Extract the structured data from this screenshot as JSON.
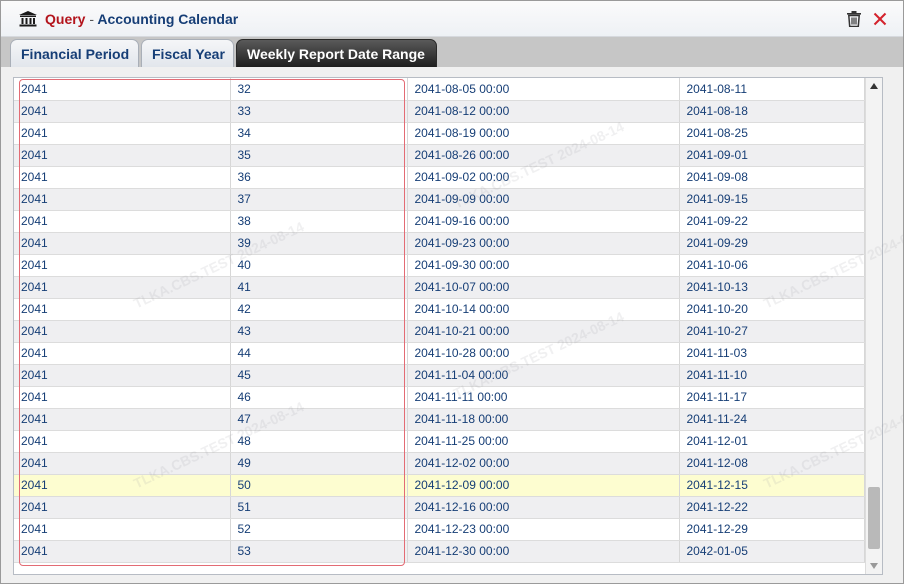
{
  "window": {
    "title_prefix": "Query",
    "title_separator": "-",
    "title": "Accounting Calendar",
    "icons": {
      "app": "bank-icon",
      "delete": "trash-icon",
      "close": "close-icon"
    }
  },
  "tabs": [
    {
      "label": "Financial Period",
      "active": false
    },
    {
      "label": "Fiscal Year",
      "active": false
    },
    {
      "label": "Weekly Report Date Range",
      "active": true
    }
  ],
  "grid": {
    "rows": [
      [
        "2041",
        "32",
        "2041-08-05 00:00",
        "2041-08-11"
      ],
      [
        "2041",
        "33",
        "2041-08-12 00:00",
        "2041-08-18"
      ],
      [
        "2041",
        "34",
        "2041-08-19 00:00",
        "2041-08-25"
      ],
      [
        "2041",
        "35",
        "2041-08-26 00:00",
        "2041-09-01"
      ],
      [
        "2041",
        "36",
        "2041-09-02 00:00",
        "2041-09-08"
      ],
      [
        "2041",
        "37",
        "2041-09-09 00:00",
        "2041-09-15"
      ],
      [
        "2041",
        "38",
        "2041-09-16 00:00",
        "2041-09-22"
      ],
      [
        "2041",
        "39",
        "2041-09-23 00:00",
        "2041-09-29"
      ],
      [
        "2041",
        "40",
        "2041-09-30 00:00",
        "2041-10-06"
      ],
      [
        "2041",
        "41",
        "2041-10-07 00:00",
        "2041-10-13"
      ],
      [
        "2041",
        "42",
        "2041-10-14 00:00",
        "2041-10-20"
      ],
      [
        "2041",
        "43",
        "2041-10-21 00:00",
        "2041-10-27"
      ],
      [
        "2041",
        "44",
        "2041-10-28 00:00",
        "2041-11-03"
      ],
      [
        "2041",
        "45",
        "2041-11-04 00:00",
        "2041-11-10"
      ],
      [
        "2041",
        "46",
        "2041-11-11 00:00",
        "2041-11-17"
      ],
      [
        "2041",
        "47",
        "2041-11-18 00:00",
        "2041-11-24"
      ],
      [
        "2041",
        "48",
        "2041-11-25 00:00",
        "2041-12-01"
      ],
      [
        "2041",
        "49",
        "2041-12-02 00:00",
        "2041-12-08"
      ],
      [
        "2041",
        "50",
        "2041-12-09 00:00",
        "2041-12-15"
      ],
      [
        "2041",
        "51",
        "2041-12-16 00:00",
        "2041-12-22"
      ],
      [
        "2041",
        "52",
        "2041-12-23 00:00",
        "2041-12-29"
      ],
      [
        "2041",
        "53",
        "2041-12-30 00:00",
        "2042-01-05"
      ]
    ],
    "selected_row_index": 18
  },
  "watermark": {
    "texts": [
      "TLKA.CBS.TEST 2024-08-14"
    ]
  },
  "colors": {
    "title_red": "#b3141c",
    "title_blue": "#163e76",
    "selected_row": "#fdfdd0",
    "highlight_border": "#e36b74"
  }
}
